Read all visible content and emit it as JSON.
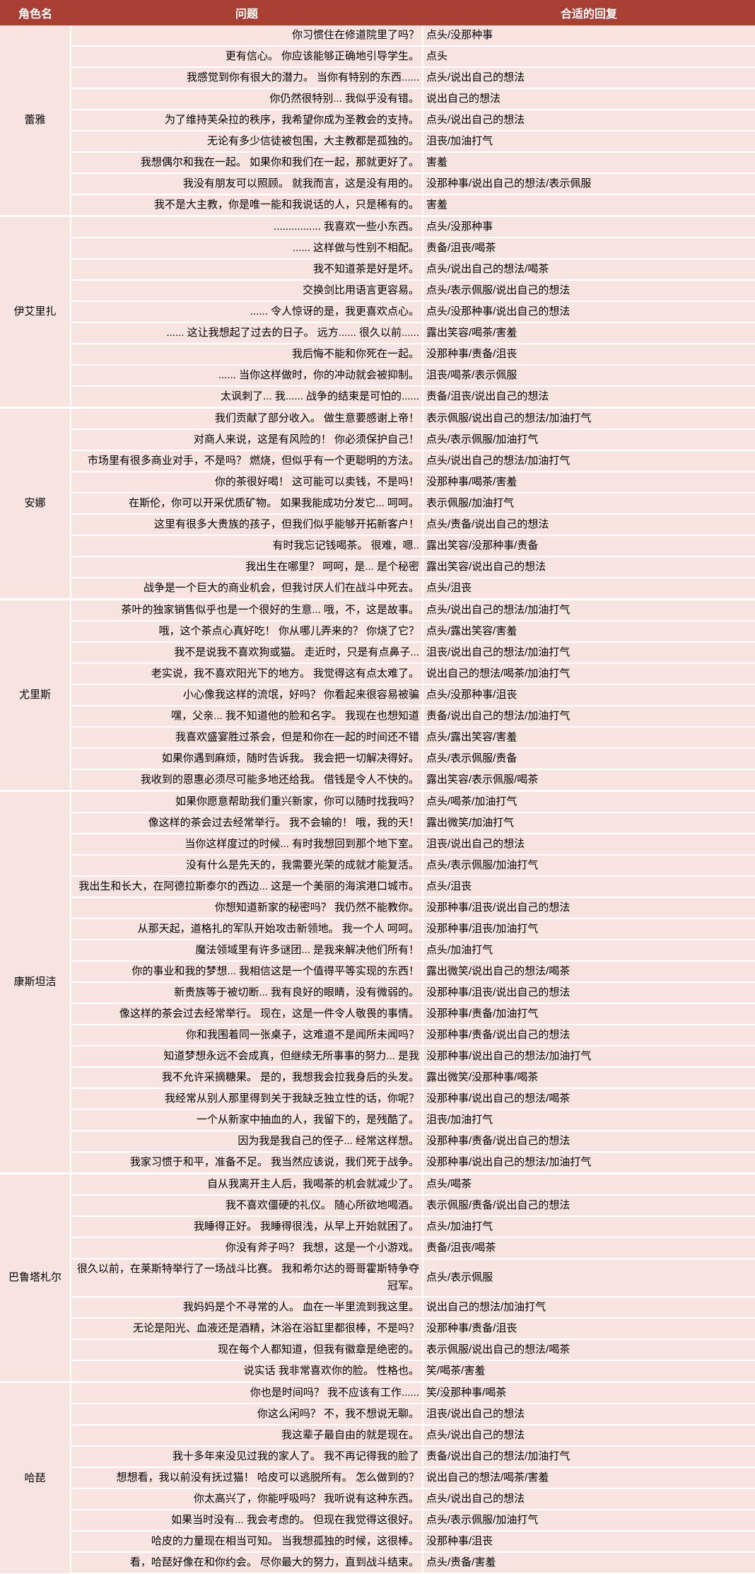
{
  "headers": {
    "character": "角色名",
    "question": "问题",
    "answer": "合适的回复"
  },
  "groups": [
    {
      "character": "蕾雅",
      "rows": [
        {
          "q": "你习惯住在修道院里了吗？",
          "a": "点头/没那种事"
        },
        {
          "q": "更有信心。 你应该能够正确地引导学生。",
          "a": "点头"
        },
        {
          "q": "我感觉到你有很大的潜力。 当你有特别的东西......",
          "a": "点头/说出自己的想法"
        },
        {
          "q": "你仍然很特别... 我似乎没有错。",
          "a": "说出自己的想法"
        },
        {
          "q": "为了维持芙朵拉的秩序，我希望你成为圣教会的支持。",
          "a": "点头/说出自己的想法"
        },
        {
          "q": "无论有多少信徒被包围，大主教都是孤独的。",
          "a": "沮丧/加油打气"
        },
        {
          "q": "我想偶尔和我在一起。 如果你和我们在一起，那就更好了。",
          "a": "害羞"
        },
        {
          "q": "我没有朋友可以照顾。 就我而言，这是没有用的。",
          "a": "没那种事/说出自己的想法/表示佩服"
        },
        {
          "q": "我不是大主教，你是唯一能和我说话的人，只是稀有的。",
          "a": "害羞"
        }
      ]
    },
    {
      "character": "伊艾里扎",
      "rows": [
        {
          "q": "................ 我喜欢一些小东西。",
          "a": "点头/没那种事"
        },
        {
          "q": "...... 这样做与性别不相配。",
          "a": "责备/沮丧/喝茶"
        },
        {
          "q": "我不知道茶是好是坏。",
          "a": "点头/说出自己的想法/喝茶"
        },
        {
          "q": "交换剑比用语言更容易。",
          "a": "点头/表示佩服/说出自己的想法"
        },
        {
          "q": "...... 令人惊讶的是，我更喜欢点心。",
          "a": "点头/没那种事/说出自己的想法"
        },
        {
          "q": "...... 这让我想起了过去的日子。 远方...... 很久以前......",
          "a": "露出笑容/喝茶/害羞"
        },
        {
          "q": "我后悔不能和你死在一起。",
          "a": "没那种事/责备/沮丧"
        },
        {
          "q": "...... 当你这样做时，你的冲动就会被抑制。",
          "a": "沮丧/喝茶/表示佩服"
        },
        {
          "q": "太讽刺了... 我...... 战争的结束是可怕的......",
          "a": "责备/沮丧/说出自己的想法"
        }
      ]
    },
    {
      "character": "安娜",
      "rows": [
        {
          "q": "我们贡献了部分收入。 做生意要感谢上帝！",
          "a": "表示佩服/说出自己的想法/加油打气"
        },
        {
          "q": "对商人来说，这是有风险的！ 你必须保护自己！",
          "a": "点头/表示佩服/加油打气"
        },
        {
          "q": "市场里有很多商业对手，不是吗？ 燃烧，但似乎有一个更聪明的方法。",
          "a": "点头/说出自己的想法/加油打气"
        },
        {
          "q": "你的茶很好喝！ 这可能可以卖钱，不是吗！",
          "a": "没那种事/喝茶/害羞"
        },
        {
          "q": "在斯伦，你可以开采优质矿物。 如果我能成功分发它... 呵呵。",
          "a": "表示佩服/加油打气"
        },
        {
          "q": "这里有很多大贵族的孩子，但我们似乎能够开拓新客户！",
          "a": "点头/责备/说出自己的想法"
        },
        {
          "q": "有时我忘记钱喝茶。 很难，嗯..",
          "a": "露出笑容/没那种事/责备"
        },
        {
          "q": "我出生在哪里？ 呵呵，是... 是个秘密",
          "a": "露出笑容/说出自己的想法"
        },
        {
          "q": "战争是一个巨大的商业机会，但我讨厌人们在战斗中死去。",
          "a": "点头/沮丧"
        }
      ]
    },
    {
      "character": "尤里斯",
      "rows": [
        {
          "q": "茶叶的独家销售似乎也是一个很好的生意... 哦，不，这是故事。",
          "a": "点头/说出自己的想法/加油打气"
        },
        {
          "q": "哦，这个茶点心真好吃！ 你从哪儿弄来的？ 你烧了它？",
          "a": "点头/露出笑容/害羞"
        },
        {
          "q": "我不是说我不喜欢狗或猫。 走近时，只是有点鼻子...",
          "a": "沮丧/说出自己的想法/加油打气"
        },
        {
          "q": "老实说，我不喜欢阳光下的地方。 我觉得这有点太难了。",
          "a": "说出自己的想法/喝茶/加油打气"
        },
        {
          "q": "小心像我这样的流氓，好吗？ 你看起来很容易被骗",
          "a": "点头/没那种事/沮丧"
        },
        {
          "q": "嘿，父亲... 我不知道他的脸和名字。 我现在也想知道",
          "a": "责备/说出自己的想法/加油打气"
        },
        {
          "q": "我喜欢盛宴胜过茶会，但是和你在一起的时间还不错",
          "a": "点头/露出笑容/害羞"
        },
        {
          "q": "如果你遇到麻烦，随时告诉我。 我会把一切解决得好。",
          "a": "点头/表示佩服/责备"
        },
        {
          "q": "我收到的恩惠必须尽可能多地还给我。 借钱是令人不快的。",
          "a": "露出笑容/表示佩服/喝茶"
        }
      ]
    },
    {
      "character": "康斯坦洁",
      "rows": [
        {
          "q": "如果你愿意帮助我们重兴新家，你可以随时找我吗？",
          "a": "点头/喝茶/加油打气"
        },
        {
          "q": "像这样的茶会过去经常举行。 我不会输的！ 哦，我的天！",
          "a": "露出微笑/加油打气"
        },
        {
          "q": "当你这样度过的时候... 有时我想回到那个地下室。",
          "a": "沮丧/说出自己的想法"
        },
        {
          "q": "没有什么是先天的，我需要光荣的成就才能复活。",
          "a": "点头/表示佩服/加油打气"
        },
        {
          "q": "我出生和长大，在阿德拉斯泰尔的西边... 这是一个美丽的海滨港口城市。",
          "a": "点头/沮丧"
        },
        {
          "q": "你想知道新家的秘密吗？ 我仍然不能教你。",
          "a": "没那种事/沮丧/说出自己的想法"
        },
        {
          "q": "从那天起，道格扎的军队开始攻击新领地。 我一个人 呵呵。",
          "a": "没那种事/沮丧/加油打气"
        },
        {
          "q": "魔法领域里有许多谜团... 是我来解决他们所有！",
          "a": "点头/加油打气"
        },
        {
          "q": "你的事业和我的梦想... 我相信这是一个值得平等实现的东西！",
          "a": "露出微笑/说出自己的想法/喝茶"
        },
        {
          "q": "新贵族等于被切断... 我有良好的眼睛，没有微弱的。",
          "a": "没那种事/沮丧/说出自己的想法"
        },
        {
          "q": "像这样的茶会过去经常举行。 现在，这是一件令人敬畏的事情。",
          "a": "没那种事/责备/加油打气"
        },
        {
          "q": "你和我围着同一张桌子，这难道不是闻所未闻吗？",
          "a": "没那种事/责备/说出自己的想法"
        },
        {
          "q": "知道梦想永远不会成真，但继续无所事事的努力... 是我",
          "a": "没那种事/说出自己的想法/加油打气"
        },
        {
          "q": "我不允许采摘糖果。 是的，我想我会拉我身后的头发。",
          "a": "露出微笑/没那种事/喝茶"
        },
        {
          "q": "我经常从别人那里得到关于我缺乏独立性的话，你呢？",
          "a": "没那种事/说出自己的想法/喝茶"
        },
        {
          "q": "一个从新家中抽血的人，我留下的，是残酷了。",
          "a": "沮丧/加油打气"
        },
        {
          "q": "因为我是我自己的侄子... 经常这样想。",
          "a": "没那种事/责备/说出自己的想法"
        },
        {
          "q": "我家习惯于和平，准备不足。 我当然应该说，我们死于战争。",
          "a": "没那种事/说出自己的想法/加油打气"
        }
      ]
    },
    {
      "character": "巴鲁塔札尔",
      "rows": [
        {
          "q": "自从我离开主人后，我喝茶的机会就减少了。",
          "a": "点头/喝茶"
        },
        {
          "q": "我不喜欢僵硬的礼仪。 随心所欲地喝酒。",
          "a": "表示佩服/责备/说出自己的想法"
        },
        {
          "q": "我睡得正好。 我睡得很浅，从早上开始就困了。",
          "a": "点头/加油打气"
        },
        {
          "q": "你没有斧子吗？ 我想，这是一个小游戏。",
          "a": "责备/沮丧/喝茶"
        },
        {
          "q": "很久以前，在莱斯特举行了一场战斗比赛。 我和希尔达的哥哥霍斯特争夺冠军。",
          "a": "点头/表示佩服"
        },
        {
          "q": "我妈妈是个不寻常的人。 血在一半里流到我这里。",
          "a": "说出自己的想法/加油打气"
        },
        {
          "q": "无论是阳光、血液还是酒精，沐浴在浴缸里都很棒，不是吗？",
          "a": "没那种事/责备/沮丧"
        },
        {
          "q": "现在每个人都知道，但我有徽章是绝密的。",
          "a": "表示佩服/说出自己的想法/喝茶"
        },
        {
          "q": "说实话 我非常喜欢你的脸。 性格也。",
          "a": "笑/喝茶/害羞"
        }
      ]
    },
    {
      "character": "哈琵",
      "rows": [
        {
          "q": "你也是时间吗？ 我不应该有工作......",
          "a": "笑/没那种事/喝茶"
        },
        {
          "q": "你这么闲吗？ 不，我不想说无聊。",
          "a": "沮丧/说出自己的想法"
        },
        {
          "q": "我这辈子最自由的就是现在。",
          "a": "点头/说出自己的想法"
        },
        {
          "q": "我十多年来没见过我的家人了。 我不再记得我的脸了",
          "a": "责备/说出自己的想法/加油打气"
        },
        {
          "q": "想想看，我以前没有抚过猫！ 哈皮可以逃脱所有。 怎么做到的？",
          "a": "说出自己的想法/喝茶/害羞"
        },
        {
          "q": "你太高兴了，你能呼吸吗？ 我听说有这种东西。",
          "a": "点头/说出自己的想法"
        },
        {
          "q": "如果当时没有... 我会考虑的。 但现在我觉得这很好。",
          "a": "点头/表示佩服/加油打气"
        },
        {
          "q": "哈皮的力量现在相当可知。 当我想孤独的时候，这很棒。",
          "a": "没那种事/沮丧"
        },
        {
          "q": "看，哈琵好像在和你约会。 尽你最大的努力，直到战斗结束。",
          "a": "点头/责备/害羞"
        }
      ]
    }
  ]
}
